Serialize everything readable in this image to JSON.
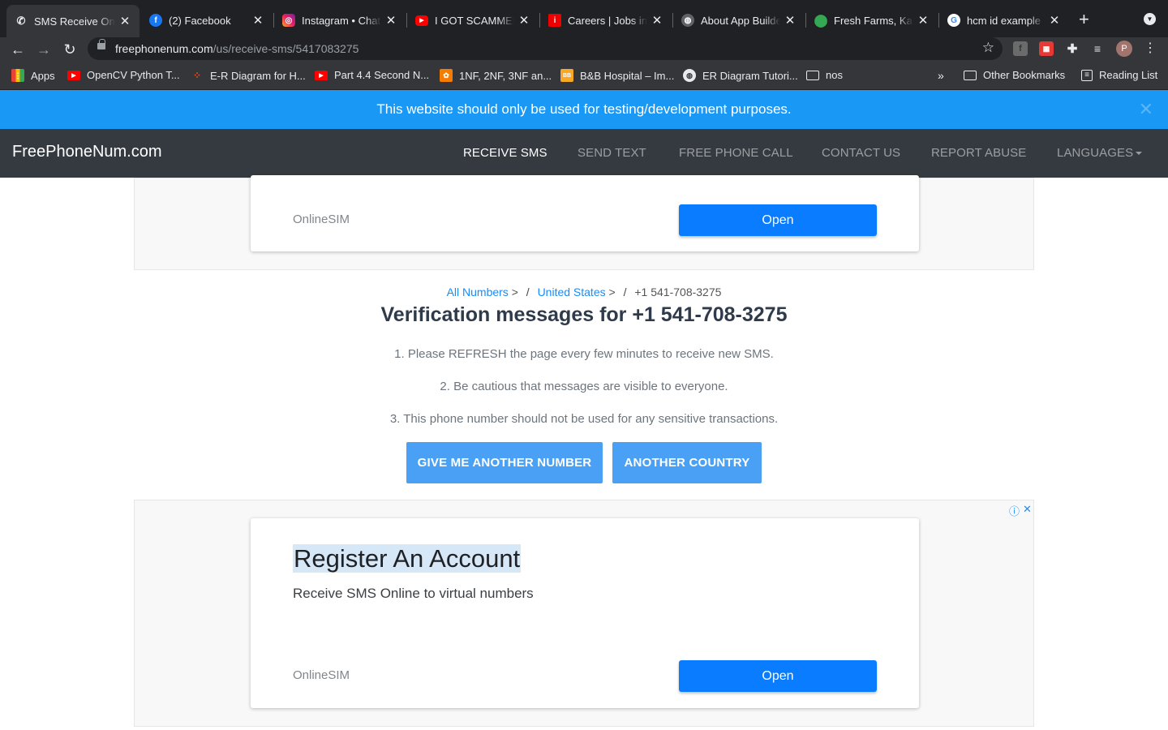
{
  "tabs": [
    {
      "title": "SMS Receive Online",
      "icon": "phone-icon",
      "active": true
    },
    {
      "title": "(2) Facebook",
      "icon": "facebook-icon",
      "active": false
    },
    {
      "title": "Instagram • Chats",
      "icon": "instagram-icon",
      "active": false
    },
    {
      "title": "I GOT SCAMMED",
      "icon": "youtube-icon",
      "active": false
    },
    {
      "title": "Careers | Jobs in",
      "icon": "careers-icon",
      "active": false
    },
    {
      "title": "About App Builder",
      "icon": "globe-icon",
      "active": false
    },
    {
      "title": "Fresh Farms, Kath",
      "icon": "maps-pin-icon",
      "active": false
    },
    {
      "title": "hcm id example -",
      "icon": "google-icon",
      "active": false
    }
  ],
  "omnibox": {
    "domain": "freephonenum.com",
    "path": "/us/receive-sms/5417083275"
  },
  "profile": {
    "initial": "P"
  },
  "bookmarks": [
    {
      "label": "Apps",
      "icon": "apps-grid-icon"
    },
    {
      "label": "OpenCV Python T...",
      "icon": "youtube-icon"
    },
    {
      "label": "E-R Diagram for H...",
      "icon": "figma-icon"
    },
    {
      "label": "Part 4.4 Second N...",
      "icon": "youtube-icon"
    },
    {
      "label": "1NF, 2NF, 3NF an...",
      "icon": "bookmark-site-icon"
    },
    {
      "label": "B&B Hospital – Im...",
      "icon": "bb-icon"
    },
    {
      "label": "ER Diagram Tutori...",
      "icon": "globe-icon"
    },
    {
      "label": "nos",
      "icon": "folder-icon"
    }
  ],
  "bookmarks_more": "»",
  "other_bookmarks": "Other Bookmarks",
  "reading_list": "Reading List",
  "banner": {
    "text": "This website should only be used for testing/development purposes.",
    "close": "✕"
  },
  "site": {
    "brand": "FreePhoneNum.com",
    "nav": [
      "RECEIVE SMS",
      "SEND TEXT",
      "FREE PHONE CALL",
      "CONTACT US",
      "REPORT ABUSE",
      "LANGUAGES"
    ],
    "active_nav": "RECEIVE SMS"
  },
  "top_ad": {
    "source": "OnlineSIM",
    "button": "Open"
  },
  "breadcrumb": {
    "all_numbers": "All Numbers",
    "country": "United States",
    "current": "+1 541-708-3275",
    "arrow": ">",
    "slash": "/"
  },
  "heading": "Verification messages for +1 541-708-3275",
  "notes": [
    "1. Please REFRESH the page every few minutes to receive new SMS.",
    "2. Be cautious that messages are visible to everyone.",
    "3. This phone number should not be used for any sensitive transactions."
  ],
  "buttons": {
    "another_number": "GIVE ME ANOTHER NUMBER",
    "another_country": "ANOTHER COUNTRY"
  },
  "bottom_ad": {
    "title": "Register An Account",
    "subtitle": "Receive SMS Online to virtual numbers",
    "source": "OnlineSIM",
    "button": "Open",
    "adchoices_info": "ⓘ",
    "adchoices_close": "✕"
  },
  "colors": {
    "banner": "#1a98f5",
    "navbar": "#343a40",
    "primary_button": "#4aa0f4",
    "ad_button": "#0a7cff",
    "link": "#1a8cf5"
  }
}
